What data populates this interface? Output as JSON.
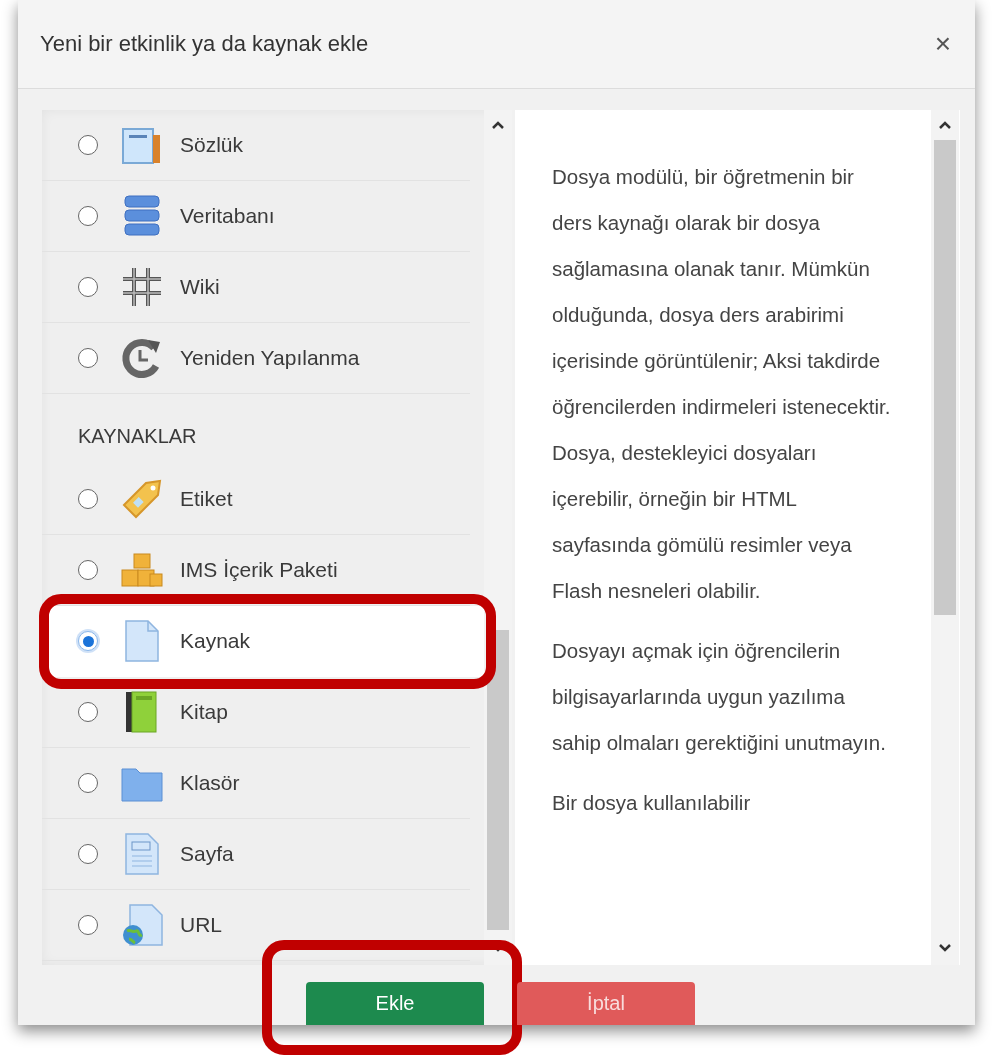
{
  "dialog": {
    "title": "Yeni bir etkinlik ya da kaynak ekle",
    "close": "×"
  },
  "modules": [
    {
      "kind": "item",
      "label": "Sözlük",
      "selected": false,
      "highlighted": false
    },
    {
      "kind": "item",
      "label": "Veritabanı",
      "selected": false,
      "highlighted": false
    },
    {
      "kind": "item",
      "label": "Wiki",
      "selected": false,
      "highlighted": false
    },
    {
      "kind": "item",
      "label": "Yeniden Yapılanma",
      "selected": false,
      "highlighted": false
    },
    {
      "kind": "section",
      "label": "KAYNAKLAR"
    },
    {
      "kind": "item",
      "label": "Etiket",
      "selected": false,
      "highlighted": false
    },
    {
      "kind": "item",
      "label": "IMS İçerik Paketi",
      "selected": false,
      "highlighted": false
    },
    {
      "kind": "item",
      "label": "Kaynak",
      "selected": true,
      "highlighted": true
    },
    {
      "kind": "item",
      "label": "Kitap",
      "selected": false,
      "highlighted": false
    },
    {
      "kind": "item",
      "label": "Klasör",
      "selected": false,
      "highlighted": false
    },
    {
      "kind": "item",
      "label": "Sayfa",
      "selected": false,
      "highlighted": false
    },
    {
      "kind": "item",
      "label": "URL",
      "selected": false,
      "highlighted": false
    }
  ],
  "description": {
    "paragraphs": [
      "Dosya modülü, bir öğretmenin bir ders kaynağı olarak bir dosya sağlamasına olanak tanır. Mümkün olduğunda, dosya ders arabirimi içerisinde görüntülenir; Aksi takdirde öğrencilerden indirmeleri istenecektir. Dosya, destekleyici dosyaları içerebilir, örneğin bir HTML sayfasında gömülü resimler veya Flash nesneleri olabilir.",
      "Dosyayı açmak için öğrencilerin bilgisayarlarında uygun yazılıma sahip olmaları gerektiğini unutmayın.",
      "Bir dosya kullanılabilir"
    ]
  },
  "buttons": [
    {
      "kind": "primary",
      "label": "Ekle",
      "highlighted": true
    },
    {
      "kind": "danger",
      "label": "İptal",
      "highlighted": false
    }
  ]
}
